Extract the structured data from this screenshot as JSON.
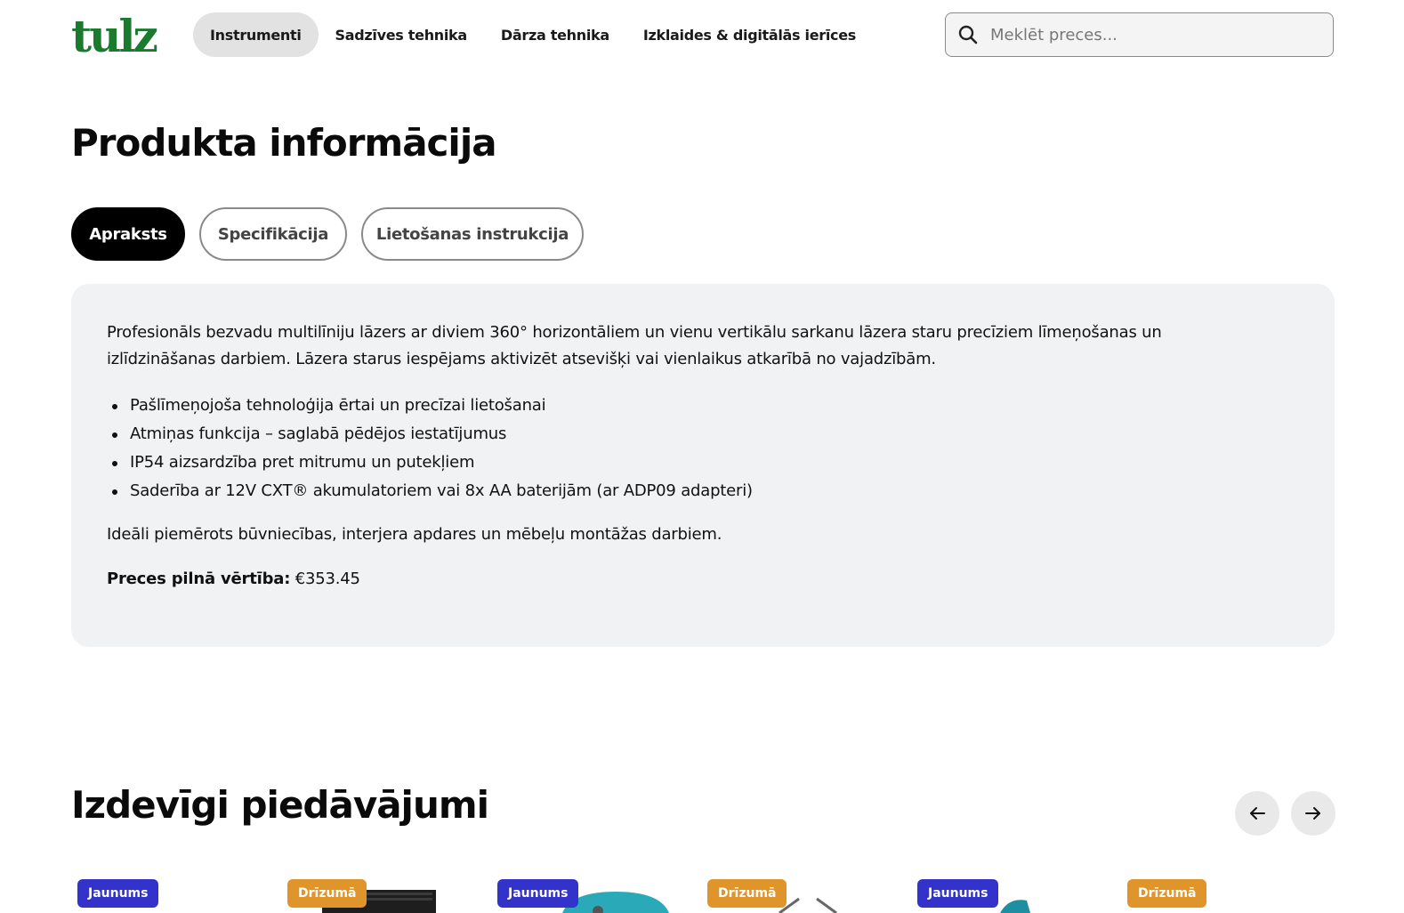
{
  "header": {
    "logo_text": "tulz",
    "nav": [
      {
        "label": "Instrumenti",
        "active": true
      },
      {
        "label": "Sadzīves tehnika",
        "active": false
      },
      {
        "label": "Dārza tehnika",
        "active": false
      },
      {
        "label": "Izklaides & digitālās ierīces",
        "active": false
      }
    ],
    "search": {
      "placeholder": "Meklēt preces...",
      "value": "",
      "icon": "search-icon"
    }
  },
  "product_info": {
    "title": "Produkta informācija",
    "tabs": [
      {
        "label": "Apraksts",
        "active": true
      },
      {
        "label": "Specifikācija",
        "active": false
      },
      {
        "label": "Lietošanas instrukcija",
        "active": false
      }
    ],
    "description": "Profesionāls bezvadu multilīniju lāzers ar diviem 360° horizontāliem un vienu vertikālu sarkanu lāzera staru precīziem līmeņošanas un izlīdzināšanas darbiem. Lāzera starus iespējams aktivizēt atsevišķi vai vienlaikus atkarībā no vajadzībām.",
    "bullets": [
      "Pašlīmeņojoša tehnoloģija ērtai un precīzai lietošanai",
      "Atmiņas funkcija – saglabā pēdējos iestatījumus",
      "IP54 aizsardzība pret mitrumu un putekļiem",
      "Saderība ar 12V CXT® akumulatoriem vai 8x AA baterijām (ar ADP09 adapteri)"
    ],
    "ideal": "Ideāli piemērots būvniecības, interjera apdares un mēbeļu montāžas darbiem.",
    "price_label": "Preces pilnā vērtība:",
    "price_value": "€353.45"
  },
  "offers": {
    "title": "Izdevīgi piedāvājumi",
    "prev_icon": "arrow-left-icon",
    "next_icon": "arrow-right-icon",
    "cards": [
      {
        "badge": "Jaunums",
        "type": "new"
      },
      {
        "badge": "Drīzumā",
        "type": "soon"
      },
      {
        "badge": "Jaunums",
        "type": "new"
      },
      {
        "badge": "Drīzumā",
        "type": "soon"
      },
      {
        "badge": "Jaunums",
        "type": "new"
      },
      {
        "badge": "Drīzumā",
        "type": "soon"
      }
    ]
  },
  "colors": {
    "brand_green": "#1a7a2e",
    "badge_new": "#3333cc",
    "badge_soon": "#e0952a",
    "panel_bg": "#f1f2f3"
  }
}
